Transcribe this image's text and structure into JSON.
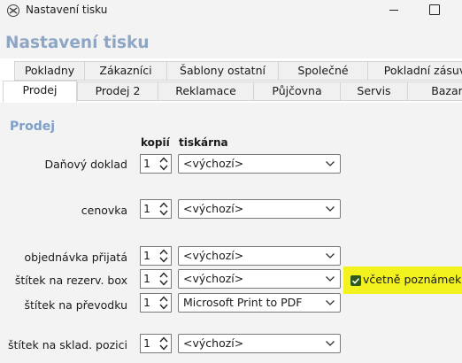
{
  "window": {
    "title": "Nastavení tisku"
  },
  "header": {
    "title": "Nastavení tisku"
  },
  "tabs_row1": [
    "Pokladny",
    "Zákazníci",
    "Šablony ostatní",
    "Společné",
    "Pokladní zásuv"
  ],
  "tabs_row2": [
    "Prodej",
    "Prodej 2",
    "Reklamace",
    "Půjčovna",
    "Servis",
    "Bazar"
  ],
  "active_tab": "Prodej",
  "section": {
    "title": "Prodej",
    "col_copies": "kopií",
    "col_printer": "tiskárna"
  },
  "rows": [
    {
      "label": "Daňový doklad",
      "copies": "1",
      "printer": "<výchozí>"
    },
    {
      "label": "cenovka",
      "copies": "1",
      "printer": "<výchozí>"
    },
    {
      "label": "objednávka přijatá",
      "copies": "1",
      "printer": "<výchozí>"
    },
    {
      "label": "štítek na rezerv. box",
      "copies": "1",
      "printer": "<výchozí>"
    },
    {
      "label": "štítek na převodku",
      "copies": "1",
      "printer": "Microsoft Print to PDF"
    },
    {
      "label": "štítek na sklad. pozici",
      "copies": "1",
      "printer": "<výchozí>"
    }
  ],
  "include_notes": {
    "label": "včetně poznámek",
    "checked": true
  },
  "colors": {
    "header_title": "#8ea6c5",
    "section_title": "#7e9fc8",
    "highlight": "#f2f21f",
    "checkbox": "#2f5a1e"
  }
}
